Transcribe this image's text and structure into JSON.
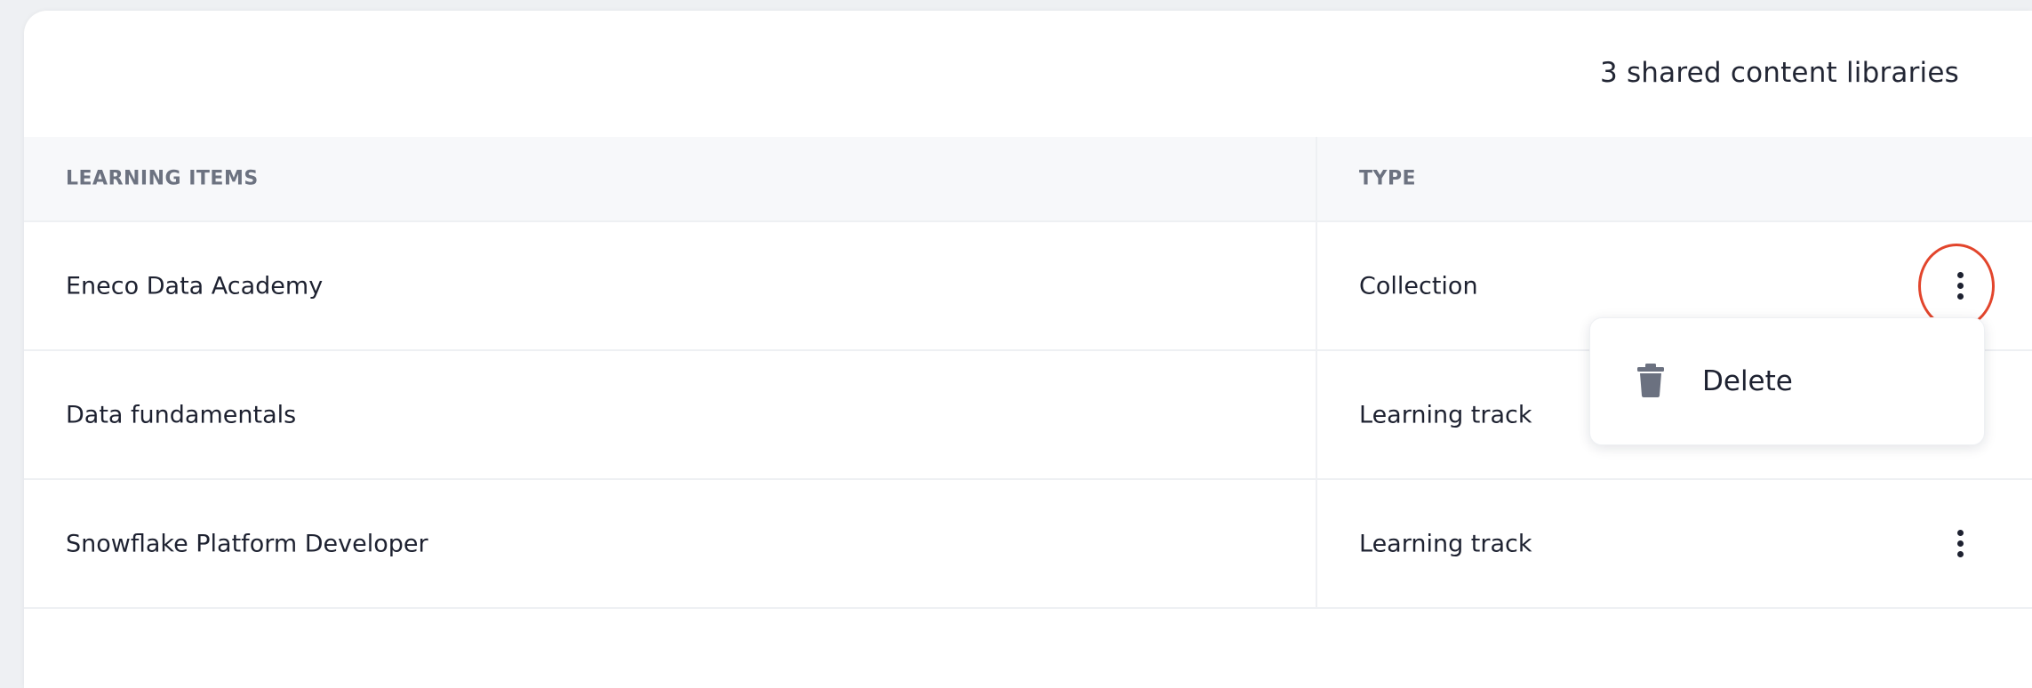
{
  "summary": "3 shared content libraries",
  "table": {
    "headers": {
      "name": "LEARNING ITEMS",
      "type": "TYPE"
    },
    "rows": [
      {
        "name": "Eneco Data Academy",
        "type": "Collection",
        "has_actions": true
      },
      {
        "name": "Data fundamentals",
        "type": "Learning track",
        "has_actions": false
      },
      {
        "name": "Snowflake Platform Developer",
        "type": "Learning track",
        "has_actions": true
      }
    ]
  },
  "context_menu": {
    "items": [
      {
        "label": "Delete",
        "icon": "trash-icon"
      }
    ]
  },
  "colors": {
    "highlight": "#e2452c",
    "icon_gray": "#6b7180",
    "text": "#1d2130"
  }
}
